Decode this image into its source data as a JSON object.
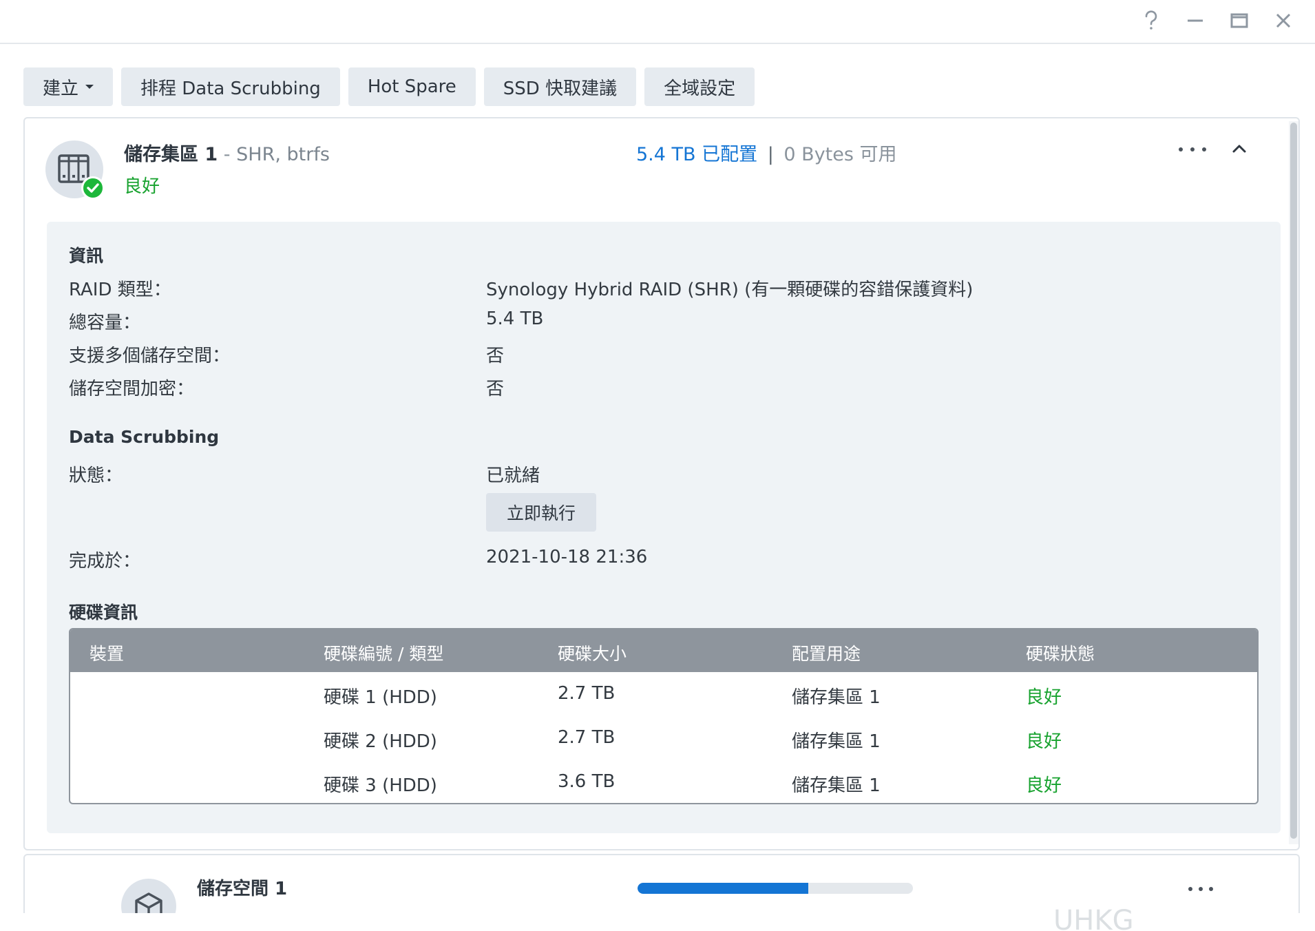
{
  "toolbar": {
    "create_label": "建立",
    "scrubbing_label": "排程 Data Scrubbing",
    "hotspare_label": "Hot Spare",
    "ssd_label": "SSD 快取建議",
    "global_label": "全域設定"
  },
  "pool": {
    "name": "儲存集區 1",
    "meta_sep": "-",
    "meta": "SHR, btrfs",
    "status": "良好",
    "used": "5.4 TB 已配置",
    "usage_sep": "|",
    "free": "0 Bytes 可用"
  },
  "info": {
    "title": "資訊",
    "raid_label": "RAID 類型：",
    "raid_value": "Synology Hybrid RAID (SHR) (有一顆硬碟的容錯保護資料)",
    "capacity_label": "總容量：",
    "capacity_value": "5.4 TB",
    "multi_label": "支援多個儲存空間：",
    "multi_value": "否",
    "encrypt_label": "儲存空間加密：",
    "encrypt_value": "否"
  },
  "scrubbing": {
    "title": "Data Scrubbing",
    "status_label": "狀態：",
    "status_value": "已就緒",
    "run_button": "立即執行",
    "finished_label": "完成於：",
    "finished_value": "2021-10-18 21:36"
  },
  "disks": {
    "title": "硬碟資訊",
    "headers": [
      "裝置",
      "硬碟編號 / 類型",
      "硬碟大小",
      "配置用途",
      "硬碟狀態"
    ],
    "rows": [
      {
        "device": "",
        "id": "硬碟 1 (HDD)",
        "size": "2.7 TB",
        "usage": "儲存集區 1",
        "status": "良好"
      },
      {
        "device": "",
        "id": "硬碟 2 (HDD)",
        "size": "2.7 TB",
        "usage": "儲存集區 1",
        "status": "良好"
      },
      {
        "device": "",
        "id": "硬碟 3 (HDD)",
        "size": "3.6 TB",
        "usage": "儲存集區 1",
        "status": "良好"
      }
    ]
  },
  "volume": {
    "name": "儲存空間 1",
    "usage_fraction": 0.62
  },
  "watermark": "UHKG",
  "colors": {
    "accent": "#1475d4",
    "good": "#17a22e",
    "button_bg": "#e6ebf0",
    "table_header": "#8e959d"
  },
  "icons": {
    "help": "help-icon",
    "minimize": "minimize-icon",
    "maximize": "maximize-icon",
    "close": "close-icon",
    "pool": "storage-pool-icon",
    "volume": "volume-cube-icon"
  }
}
